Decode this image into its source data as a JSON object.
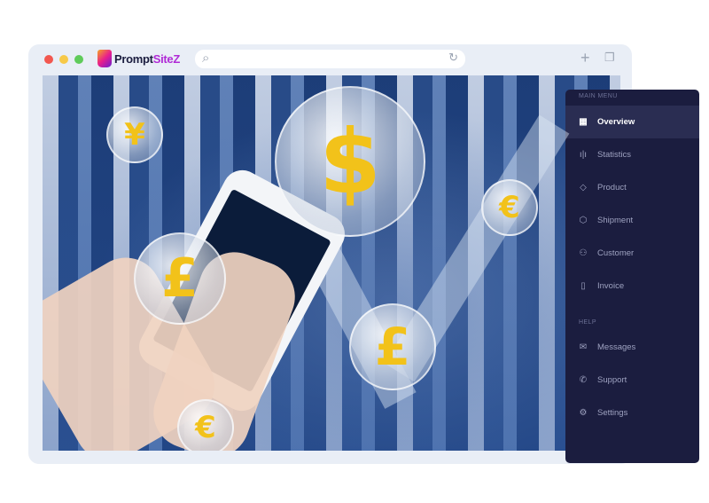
{
  "browser": {
    "logo_text_main": "Prompt",
    "logo_text_accent": "SiteZ",
    "url_value": "",
    "icons": [
      "search-icon",
      "reload-icon",
      "new-tab-icon",
      "tabs-icon"
    ]
  },
  "photo": {
    "coins": [
      "¥",
      "$",
      "€",
      "£",
      "£",
      "€"
    ]
  },
  "sidebar": {
    "main_menu_label": "MAIN MENU",
    "help_label": "HELP",
    "items": [
      {
        "label": "Overview",
        "icon": "grid-icon"
      },
      {
        "label": "Statistics",
        "icon": "bar-chart-icon"
      },
      {
        "label": "Product",
        "icon": "tag-icon"
      },
      {
        "label": "Shipment",
        "icon": "box-icon"
      },
      {
        "label": "Customer",
        "icon": "users-icon"
      },
      {
        "label": "Invoice",
        "icon": "clipboard-icon"
      }
    ],
    "help_items": [
      {
        "label": "Messages",
        "icon": "mail-icon"
      },
      {
        "label": "Support",
        "icon": "phone-icon"
      },
      {
        "label": "Settings",
        "icon": "gear-icon"
      }
    ],
    "active": "Overview"
  },
  "colors": {
    "sidebar_bg": "#1b1d3f",
    "frame_bg": "#e9eef6",
    "coin_gold": "#f2c21a"
  }
}
